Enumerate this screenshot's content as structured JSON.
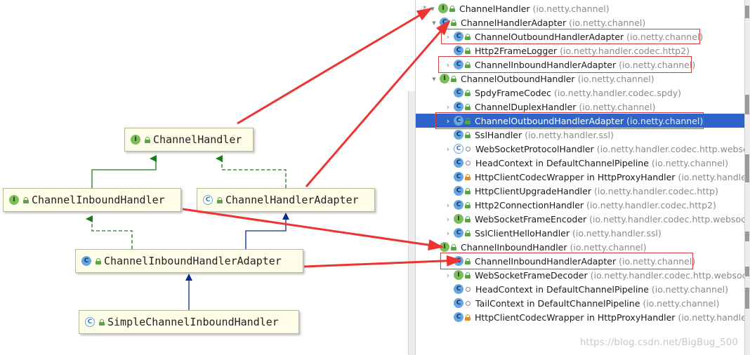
{
  "diagram": {
    "boxes": {
      "channel_handler": {
        "label": "ChannelHandler",
        "kind": "I"
      },
      "inbound_handler": {
        "label": "ChannelInboundHandler",
        "kind": "I"
      },
      "handler_adapter": {
        "label": "ChannelHandlerAdapter",
        "kind": "C"
      },
      "inbound_adapter": {
        "label": "ChannelInboundHandlerAdapter",
        "kind": "C"
      },
      "simple_inbound": {
        "label": "SimpleChannelInboundHandler",
        "kind": "C"
      }
    },
    "colors": {
      "extends": "#1b7a1b",
      "implements_dashed": "#1b7a1b",
      "class_extends": "#0b2a8a",
      "highlight_arrow": "#ee3333"
    }
  },
  "tree": {
    "rows": [
      {
        "name": "ChannelHandler",
        "pkg": "(io.netty.channel)",
        "icon": "I",
        "arrow": "▾",
        "marker": "*"
      },
      {
        "name": "ChannelHandlerAdapter",
        "pkg": "(io.netty.channel)",
        "icon": "C",
        "arrow": "▾"
      },
      {
        "name": "ChannelOutboundHandlerAdapter",
        "pkg": "(io.netty.channel)",
        "icon": "C",
        "arrow": "›"
      },
      {
        "name": "Http2FrameLogger",
        "pkg": "(io.netty.handler.codec.http2)",
        "icon": "C",
        "arrow": ""
      },
      {
        "name": "ChannelInboundHandlerAdapter",
        "pkg": "(io.netty.channel)",
        "icon": "C",
        "arrow": "›"
      },
      {
        "name": "ChannelOutboundHandler",
        "pkg": "(io.netty.channel)",
        "icon": "I",
        "arrow": "▾"
      },
      {
        "name": "SpdyFrameCodec",
        "pkg": "(io.netty.handler.codec.spdy)",
        "icon": "C",
        "arrow": ""
      },
      {
        "name": "ChannelDuplexHandler",
        "pkg": "(io.netty.channel)",
        "icon": "C",
        "arrow": "›"
      },
      {
        "name": "ChannelOutboundHandlerAdapter",
        "pkg": "(io.netty.channel)",
        "icon": "C",
        "arrow": "›",
        "selected": true
      },
      {
        "name": "SslHandler",
        "pkg": "(io.netty.handler.ssl)",
        "icon": "C",
        "arrow": ""
      },
      {
        "name": "WebSocketProtocolHandler",
        "pkg": "(io.netty.handler.codec.http.websock",
        "icon": "CA",
        "arrow": "›"
      },
      {
        "name": "HeadContext in DefaultChannelPipeline",
        "pkg": "(io.netty.channel)",
        "icon": "C",
        "arrow": ""
      },
      {
        "name": "HttpClientCodecWrapper in HttpProxyHandler",
        "pkg": "(io.netty.handler.p",
        "icon": "C",
        "arrow": ""
      },
      {
        "name": "HttpClientUpgradeHandler",
        "pkg": "(io.netty.handler.codec.http)",
        "icon": "C",
        "arrow": ""
      },
      {
        "name": "Http2ConnectionHandler",
        "pkg": "(io.netty.handler.codec.http2)",
        "icon": "C",
        "arrow": "›"
      },
      {
        "name": "WebSocketFrameEncoder",
        "pkg": "(io.netty.handler.codec.http.websocke",
        "icon": "I",
        "arrow": "›"
      },
      {
        "name": "SslClientHelloHandler",
        "pkg": "(io.netty.handler.ssl)",
        "icon": "C",
        "arrow": "›"
      },
      {
        "name": "ChannelInboundHandler",
        "pkg": "(io.netty.channel)",
        "icon": "I",
        "arrow": "▾"
      },
      {
        "name": "ChannelInboundHandlerAdapter",
        "pkg": "(io.netty.channel)",
        "icon": "C",
        "arrow": "›"
      },
      {
        "name": "WebSocketFrameDecoder",
        "pkg": "(io.netty.handler.codec.http.websocke",
        "icon": "I",
        "arrow": "›"
      },
      {
        "name": "HeadContext in DefaultChannelPipeline",
        "pkg": "(io.netty.channel)",
        "icon": "C",
        "arrow": ""
      },
      {
        "name": "TailContext in DefaultChannelPipeline",
        "pkg": "(io.netty.channel)",
        "icon": "C",
        "arrow": ""
      },
      {
        "name": "HttpClientCodecWrapper in HttpProxyHandler",
        "pkg": "(io.netty.handler.p",
        "icon": "C",
        "arrow": ""
      }
    ]
  },
  "watermark": "https://blog.csdn.net/BigBug_500"
}
